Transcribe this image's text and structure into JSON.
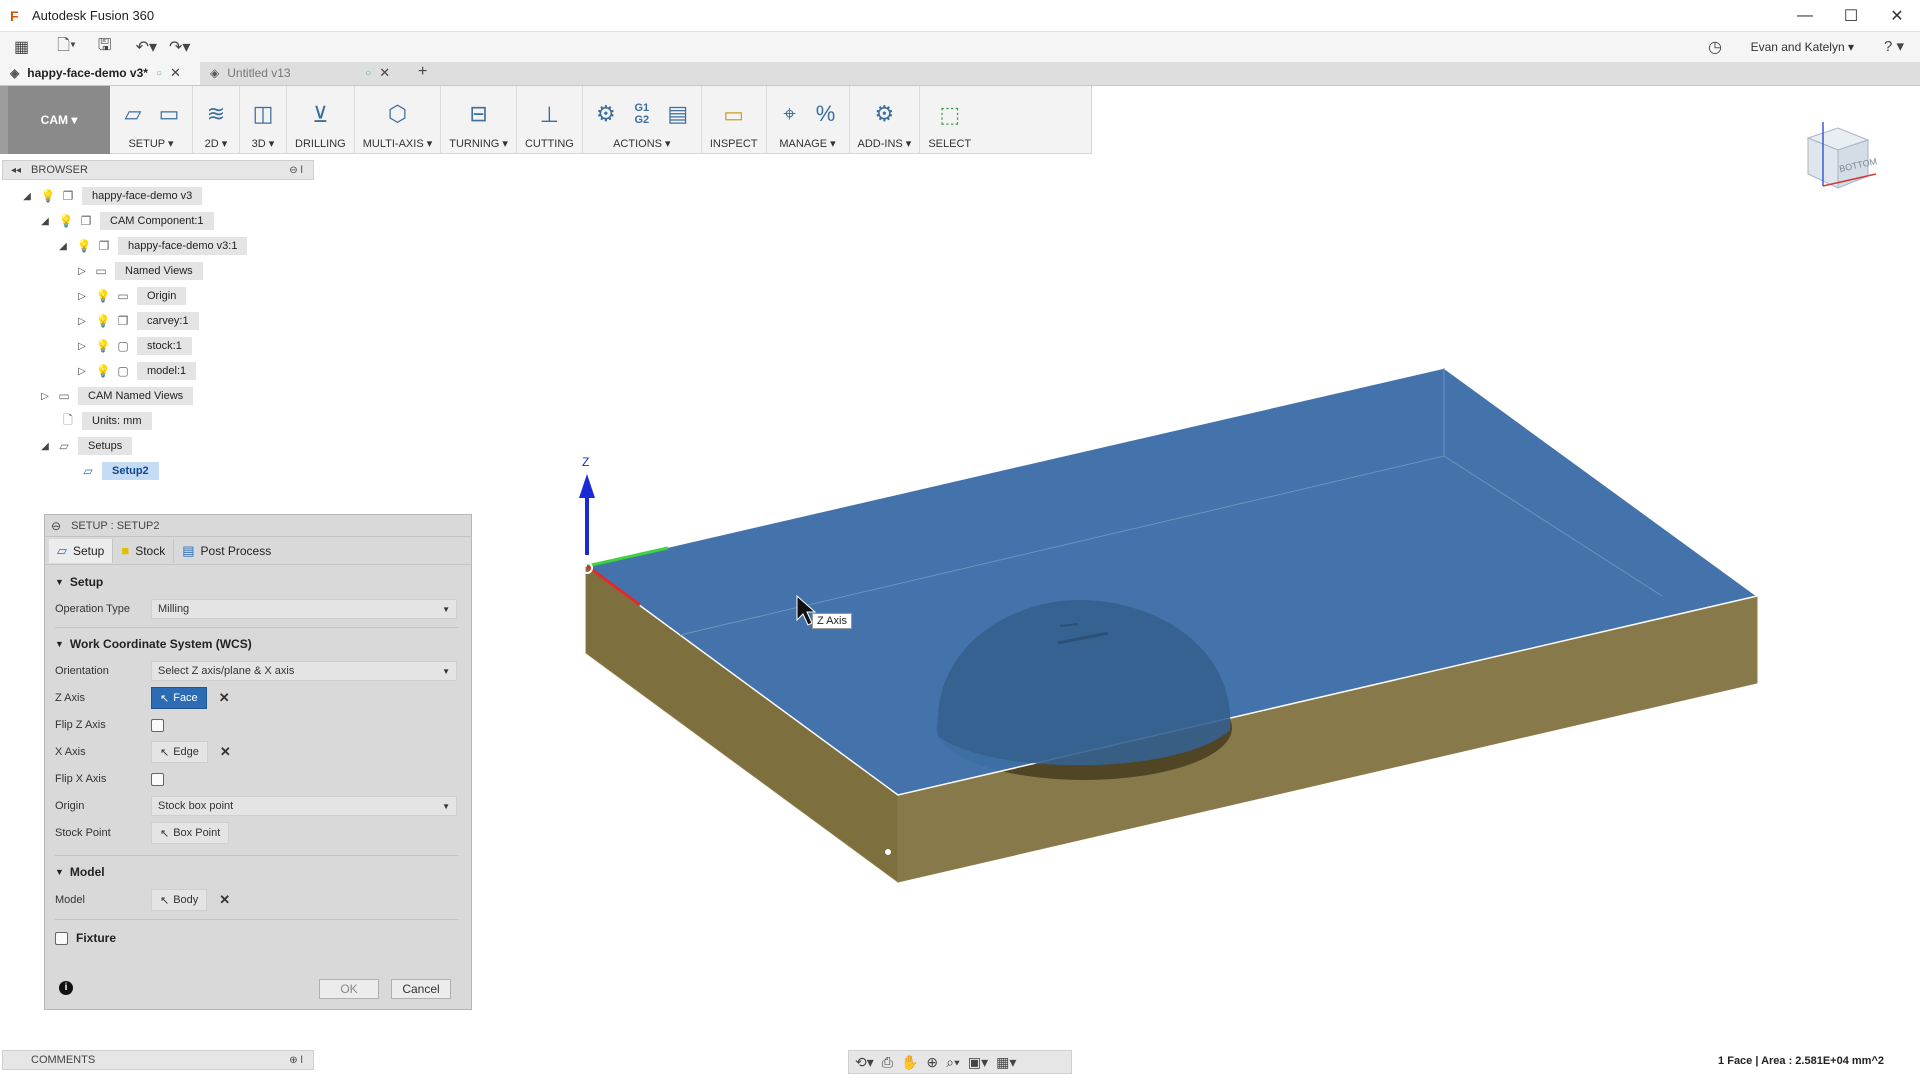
{
  "window": {
    "title": "Autodesk Fusion 360",
    "controls": [
      "—",
      "☐",
      "✕"
    ]
  },
  "quick_access": {
    "user": "Evan and Katelyn ▾",
    "help": "? ▾"
  },
  "tabs": [
    {
      "label": "happy-face-demo v3*"
    },
    {
      "label": "Untitled v13"
    }
  ],
  "ribbon": {
    "workspace": "CAM ▾",
    "groups": [
      {
        "label": "SETUP ▾",
        "icons": [
          "setup-icon",
          "open-folder-icon"
        ]
      },
      {
        "label": "2D ▾",
        "icons": [
          "2d-layers-icon"
        ]
      },
      {
        "label": "3D ▾",
        "icons": [
          "3d-surface-icon"
        ]
      },
      {
        "label": "DRILLING",
        "icons": [
          "drill-icon"
        ]
      },
      {
        "label": "MULTI-AXIS ▾",
        "icons": [
          "multi-axis-icon"
        ]
      },
      {
        "label": "TURNING ▾",
        "icons": [
          "turning-icon"
        ]
      },
      {
        "label": "CUTTING",
        "icons": [
          "cutting-icon"
        ]
      },
      {
        "label": "ACTIONS ▾",
        "icons": [
          "simulate-icon",
          "g1g2-icon",
          "setup-sheet-icon"
        ]
      },
      {
        "label": "INSPECT",
        "icons": [
          "ruler-icon"
        ]
      },
      {
        "label": "MANAGE ▾",
        "icons": [
          "tool-library-icon",
          "percent-icon"
        ]
      },
      {
        "label": "ADD-INS ▾",
        "icons": [
          "addins-icon"
        ]
      },
      {
        "label": "SELECT",
        "icons": [
          "select-icon"
        ]
      }
    ]
  },
  "browser": {
    "title": "BROWSER",
    "items": [
      {
        "label": "happy-face-demo v3"
      },
      {
        "label": "CAM Component:1"
      },
      {
        "label": "happy-face-demo v3:1"
      },
      {
        "label": "Named Views"
      },
      {
        "label": "Origin"
      },
      {
        "label": "carvey:1"
      },
      {
        "label": "stock:1"
      },
      {
        "label": "model:1"
      },
      {
        "label": "CAM Named Views"
      },
      {
        "label": "Units: mm"
      },
      {
        "label": "Setups"
      },
      {
        "label": "Setup2"
      }
    ]
  },
  "dialog": {
    "title": "SETUP : SETUP2",
    "tabs": [
      "Setup",
      "Stock",
      "Post Process"
    ],
    "setup_section": "Setup",
    "operation_type_label": "Operation Type",
    "operation_type_value": "Milling",
    "wcs_section": "Work Coordinate System (WCS)",
    "orientation_label": "Orientation",
    "orientation_value": "Select Z axis/plane & X axis",
    "z_axis_label": "Z Axis",
    "z_axis_value": "Face",
    "flip_z_label": "Flip Z Axis",
    "x_axis_label": "X Axis",
    "x_axis_value": "Edge",
    "flip_x_label": "Flip X Axis",
    "origin_label": "Origin",
    "origin_value": "Stock box point",
    "stock_point_label": "Stock Point",
    "stock_point_value": "Box Point",
    "model_section": "Model",
    "model_label": "Model",
    "model_value": "Body",
    "fixture_label": "Fixture",
    "ok": "OK",
    "cancel": "Cancel"
  },
  "comments": {
    "title": "COMMENTS"
  },
  "viewport": {
    "axis_z_label": "Z",
    "tooltip": "Z Axis",
    "viewcube_face": "BOTTOM"
  },
  "status": "1 Face | Area : 2.581E+04 mm^2"
}
